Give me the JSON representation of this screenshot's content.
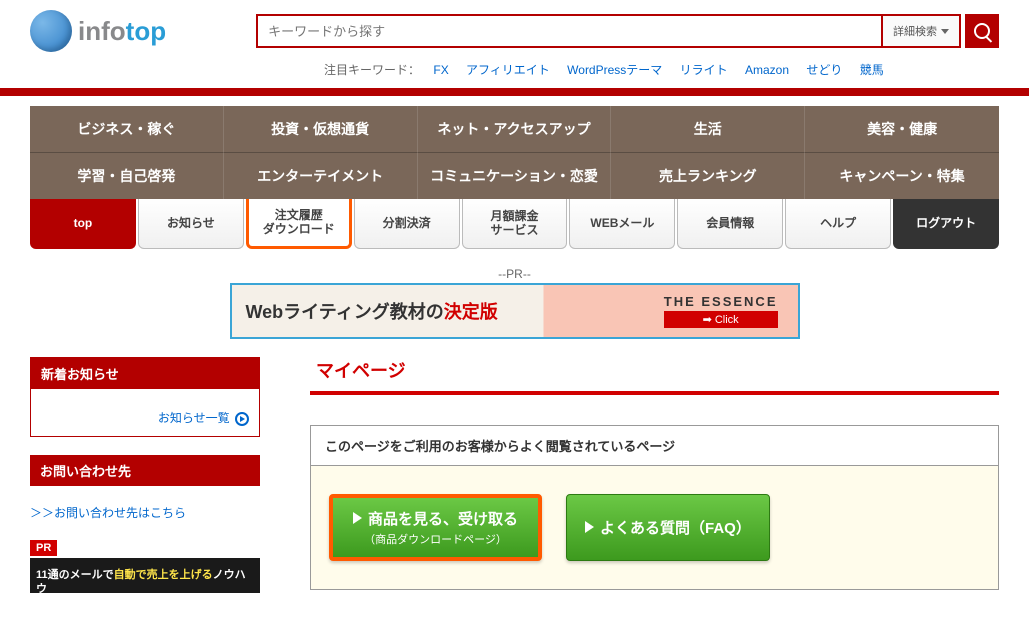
{
  "header": {
    "logo_info": "info",
    "logo_top": "top",
    "search_placeholder": "キーワードから探す",
    "adv_search": "詳細検索",
    "keywords_label": "注目キーワード：",
    "keywords": [
      "FX",
      "アフィリエイト",
      "WordPressテーマ",
      "リライト",
      "Amazon",
      "せどり",
      "競馬"
    ]
  },
  "categories": [
    "ビジネス・稼ぐ",
    "投資・仮想通貨",
    "ネット・アクセスアップ",
    "生活",
    "美容・健康",
    "学習・自己啓発",
    "エンターテイメント",
    "コミュニケーション・恋愛",
    "売上ランキング",
    "キャンペーン・特集"
  ],
  "tabs": {
    "top": "top",
    "news": "お知らせ",
    "download_l1": "注文履歴",
    "download_l2": "ダウンロード",
    "split": "分割決済",
    "monthly_l1": "月額課金",
    "monthly_l2": "サービス",
    "webmail": "WEBメール",
    "member": "会員情報",
    "help": "ヘルプ",
    "logout": "ログアウト"
  },
  "pr_label": "--PR--",
  "banner": {
    "t1": "Webライティング教材の",
    "t2": "決定版",
    "essence": "THE ESSENCE",
    "click": "➡ Click"
  },
  "sidebar": {
    "news_head": "新着お知らせ",
    "news_link": "お知らせ一覧",
    "contact_head": "お問い合わせ先",
    "contact_link": "＞＞お問い合わせ先はこちら",
    "pr_badge": "PR",
    "pr_text_1": "11通のメールで",
    "pr_text_2": "自動で売上を上げる",
    "pr_text_3": "ノウハウ"
  },
  "main": {
    "title": "マイページ",
    "panel_head": "このページをご利用のお客様からよく閲覧されているページ",
    "btn1_l1": "商品を見る、受け取る",
    "btn1_l2": "（商品ダウンロードページ）",
    "btn2": "よくある質問（FAQ）"
  }
}
